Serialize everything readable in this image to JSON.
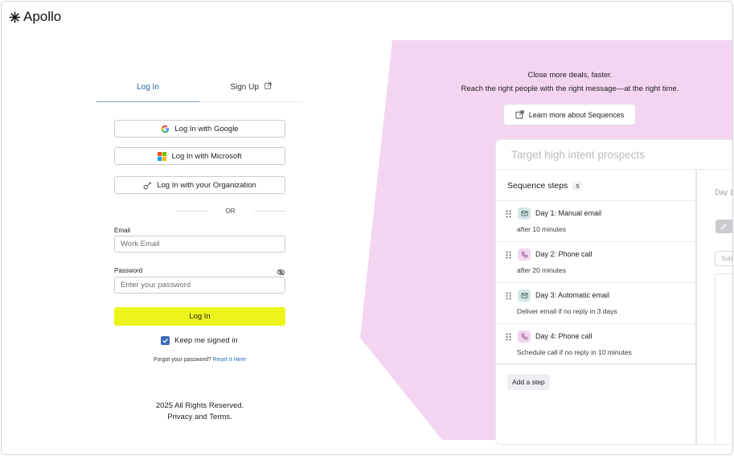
{
  "brand": {
    "name": "Apollo"
  },
  "auth": {
    "tabs": [
      {
        "label": "Log In"
      },
      {
        "label": "Sign Up"
      }
    ],
    "sso": {
      "google": "Log In with Google",
      "microsoft": "Log In with Microsoft",
      "organization": "Log In with your Organization"
    },
    "divider": "OR",
    "email": {
      "label": "Email",
      "placeholder": "Work Email"
    },
    "password": {
      "label": "Password",
      "placeholder": "Enter your password"
    },
    "submit": "Log In",
    "keep_signed_in": {
      "label": "Keep me signed in",
      "checked": true
    },
    "forgot": {
      "text": "Forgot your password?",
      "link": "Reset It Here"
    },
    "footer": {
      "line1": "2025 All Rights Reserved.",
      "line2": "Privacy and Terms."
    }
  },
  "promo": {
    "headline": "Close more deals, faster.",
    "subline": "Reach the right people with the right message—at the right time.",
    "learn_more": "Learn more about Sequences"
  },
  "sequence_card": {
    "title": "Target high intent prospects",
    "steps_label": "Sequence steps",
    "steps_count": "5",
    "steps": [
      {
        "type": "email",
        "title": "Day 1: Manual email",
        "subtitle": "after 10 minutes"
      },
      {
        "type": "phone",
        "title": "Day 2: Phone call",
        "subtitle": "after 20 minutes"
      },
      {
        "type": "email",
        "title": "Day 3: Automatic email",
        "subtitle": "Deliver email if no reply in 3 days"
      },
      {
        "type": "phone",
        "title": "Day 4: Phone call",
        "subtitle": "Schedule call if no reply in 10 minutes"
      }
    ],
    "add_step": "Add a step",
    "detail": {
      "day": "Day 1",
      "subject_placeholder": "Sub"
    }
  },
  "colors": {
    "accent_yellow": "#ecf41a",
    "pink": "#f4d5f1",
    "link_blue": "#2d69b8",
    "checkbox_blue": "#3d6cb5"
  }
}
